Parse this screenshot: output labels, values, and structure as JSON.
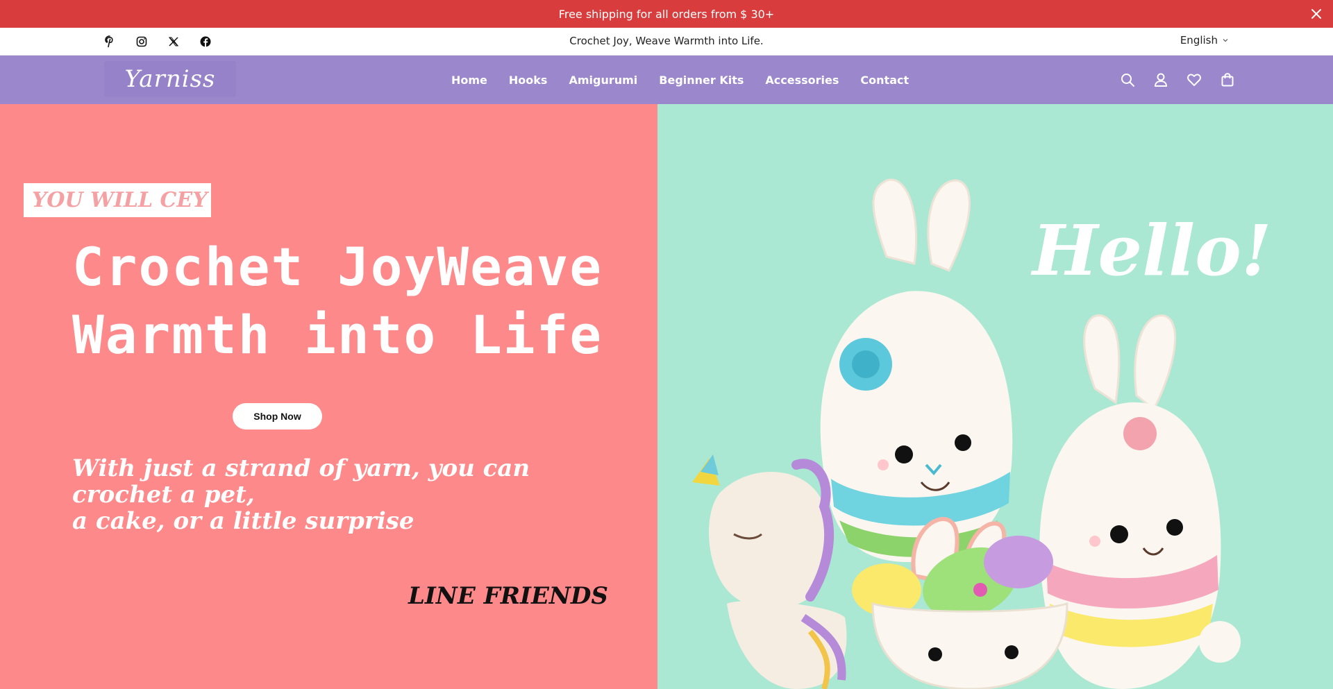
{
  "announcement": {
    "text": "Free shipping for all orders from $ 30+"
  },
  "utility": {
    "socials": [
      "pinterest-icon",
      "instagram-icon",
      "x-icon",
      "facebook-icon"
    ],
    "tagline": "Crochet Joy, Weave Warmth into Life.",
    "language": "English"
  },
  "nav": {
    "logo": "Yarniss",
    "menu": [
      "Home",
      "Hooks",
      "Amigurumi",
      "Beginner Kits",
      "Accessories",
      "Contact"
    ],
    "icons": [
      "search-icon",
      "account-icon",
      "wishlist-icon",
      "cart-icon"
    ]
  },
  "hero": {
    "badge": "YOU WILL CEY",
    "headline_line1": "Crochet JoyWeave",
    "headline_line2": "Warmth into Life",
    "cta": "Shop Now",
    "subline_line1": "With just a strand of yarn, you can crochet a pet,",
    "subline_line2": "a cake, or a little surprise",
    "brand": "LINE FRIENDS",
    "hello": "Hello!"
  },
  "colors": {
    "announce_bg": "#d93c3c",
    "nav_bg": "#9b87cb",
    "hero_left_bg": "#fe898b",
    "hero_right_bg": "#aae8d3"
  }
}
